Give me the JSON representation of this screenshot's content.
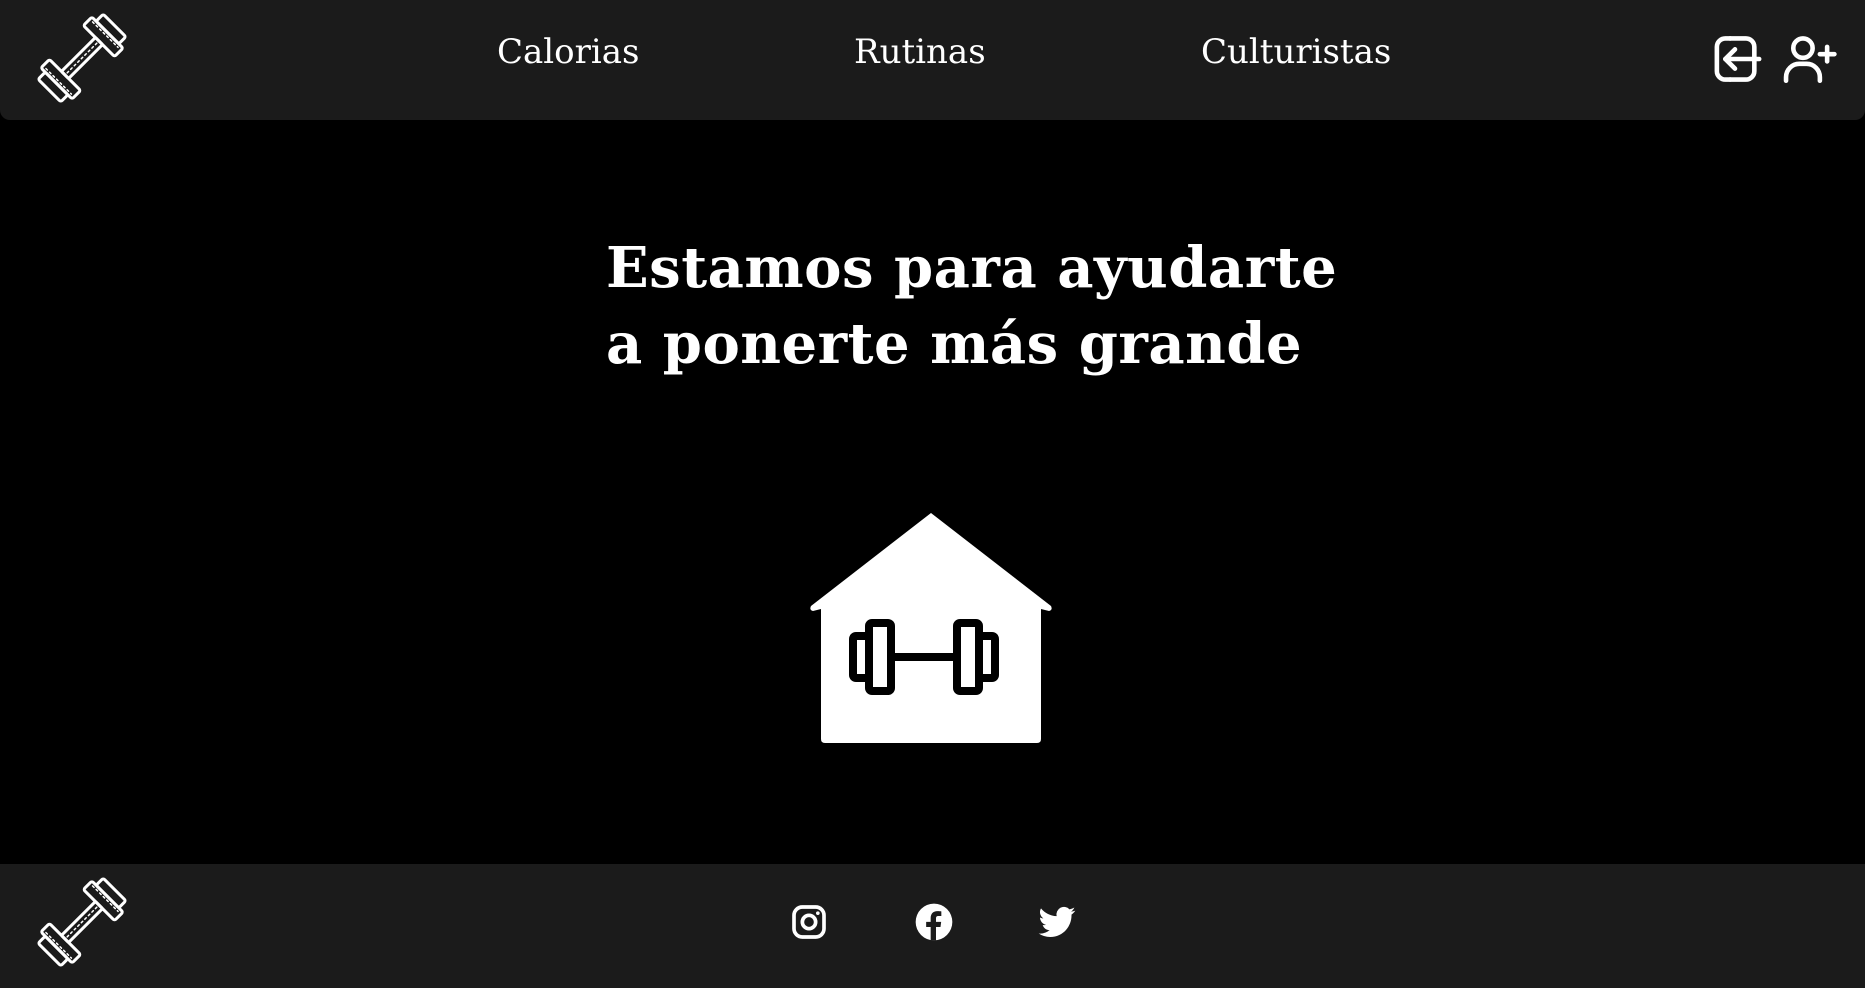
{
  "header": {
    "logo_icon": "dumbbell-icon",
    "nav": [
      {
        "label": "Calorias"
      },
      {
        "label": "Rutinas"
      },
      {
        "label": "Culturistas"
      }
    ],
    "login_icon": "login-icon",
    "register_icon": "user-plus-icon"
  },
  "hero": {
    "line1": "Estamos para ayudarte",
    "line2": "a ponerte más grande",
    "illustration_icon": "gym-house-icon"
  },
  "footer": {
    "logo_icon": "dumbbell-icon",
    "social": [
      "instagram-icon",
      "facebook-icon",
      "twitter-icon"
    ]
  },
  "colors": {
    "background": "#000000",
    "bar": "#1b1b1b",
    "text": "#ffffff"
  }
}
